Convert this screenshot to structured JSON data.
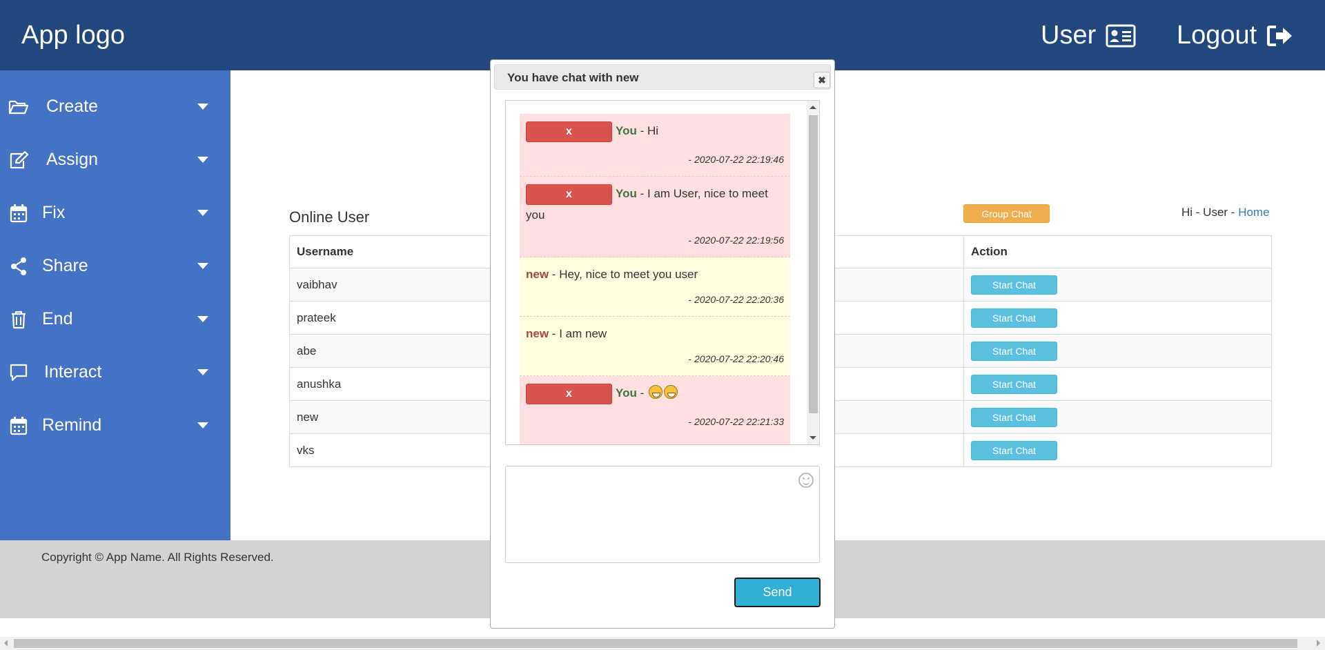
{
  "header": {
    "logo": "App logo",
    "user_label": "User",
    "logout_label": "Logout"
  },
  "sidebar": {
    "items": [
      {
        "label": "Create",
        "icon": "folder-open-icon"
      },
      {
        "label": "Assign",
        "icon": "edit-icon"
      },
      {
        "label": "Fix",
        "icon": "calendar-icon"
      },
      {
        "label": "Share",
        "icon": "share-icon"
      },
      {
        "label": "End",
        "icon": "trash-icon"
      },
      {
        "label": "Interact",
        "icon": "comment-icon"
      },
      {
        "label": "Remind",
        "icon": "calendar-icon"
      }
    ]
  },
  "main": {
    "greeting_prefix": "Hi - User -",
    "home_link": "Home",
    "group_chat_button": "Group Chat",
    "online_title": "Online User",
    "table": {
      "headers": [
        "Username",
        "Action"
      ],
      "action_label": "Start Chat",
      "rows": [
        "vaibhav",
        "prateek",
        "abe",
        "anushka",
        "new",
        "vks"
      ]
    }
  },
  "footer": {
    "copyright": "Copyright © App Name. All Rights Reserved."
  },
  "chat_dialog": {
    "title": "You have chat with new",
    "close_glyph": "✖",
    "delete_label": "x",
    "send_label": "Send",
    "messages": [
      {
        "sender": "You",
        "separator": "-",
        "text": "Hi",
        "time": "2020-07-22 22:19:46"
      },
      {
        "sender": "You",
        "separator": "-",
        "text": "I am User, nice to meet you",
        "time": "2020-07-22 22:19:56"
      },
      {
        "sender": "new",
        "separator": "-",
        "text": "Hey, nice to meet you user",
        "time": "2020-07-22 22:20:36"
      },
      {
        "sender": "new",
        "separator": "-",
        "text": "I am new",
        "time": "2020-07-22 22:20:46"
      },
      {
        "sender": "You",
        "separator": "-",
        "text": "",
        "time": "2020-07-22 22:21:33"
      }
    ],
    "time_dash": "-"
  },
  "colors": {
    "header_bg": "#21487c",
    "sidebar_bg": "#4472c4",
    "footer_bg": "#d3d3d3",
    "group_chat": "#f0ad4e",
    "start_chat": "#5bc0de",
    "delete_button": "#d9534f",
    "send_button": "#31b0d5",
    "you_message_bg": "#ffdfe0",
    "other_message_bg": "#ffffe0"
  }
}
